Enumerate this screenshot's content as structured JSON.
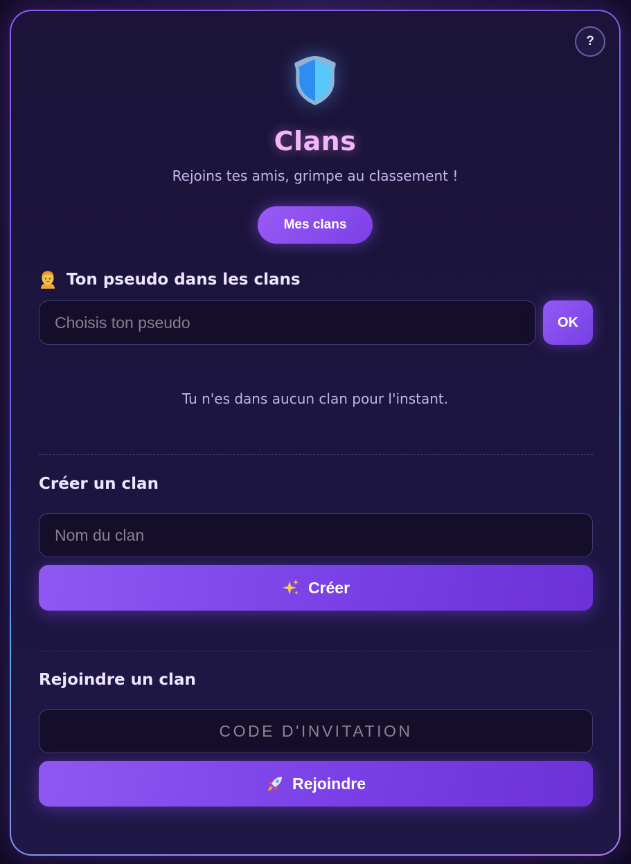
{
  "header": {
    "help_label": "?",
    "title": "Clans",
    "subtitle": "Rejoins tes amis, grimpe au classement !",
    "my_clans_label": "Mes clans"
  },
  "pseudo": {
    "heading": "Ton pseudo dans les clans",
    "placeholder": "Choisis ton pseudo",
    "value": "",
    "ok_label": "OK"
  },
  "status": {
    "empty_message": "Tu n'es dans aucun clan pour l'instant."
  },
  "create": {
    "heading": "Créer un clan",
    "placeholder": "Nom du clan",
    "value": "",
    "button_label": "Créer",
    "button_icon": "sparkles-icon"
  },
  "join": {
    "heading": "Rejoindre un clan",
    "placeholder": "CODE D'INVITATION",
    "value": "",
    "button_label": "Rejoindre",
    "button_icon": "rocket-icon"
  },
  "colors": {
    "accent": "#7b3fe6",
    "title": "#f3b6f7",
    "background": "#1c1540",
    "shield_left": "#2f8cf0",
    "shield_right": "#58c8fb"
  }
}
